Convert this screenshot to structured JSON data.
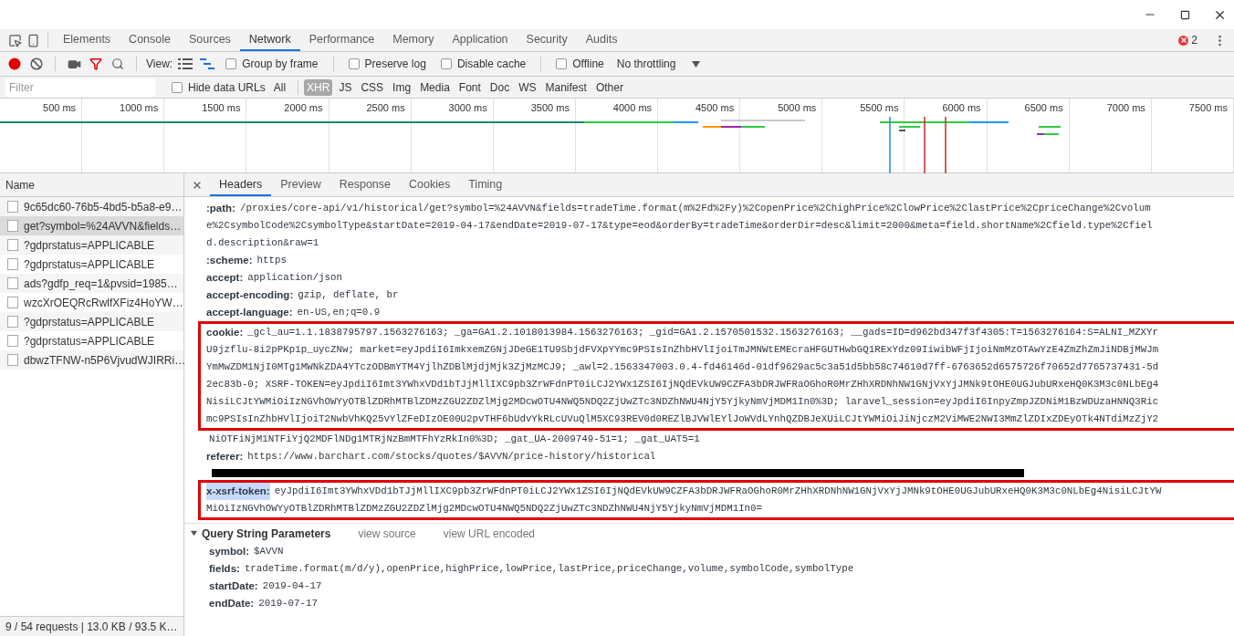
{
  "devtools_tabs": [
    {
      "label": "Elements",
      "selected": false
    },
    {
      "label": "Console",
      "selected": false
    },
    {
      "label": "Sources",
      "selected": false
    },
    {
      "label": "Network",
      "selected": true
    },
    {
      "label": "Performance",
      "selected": false
    },
    {
      "label": "Memory",
      "selected": false
    },
    {
      "label": "Application",
      "selected": false
    },
    {
      "label": "Security",
      "selected": false
    },
    {
      "label": "Audits",
      "selected": false
    }
  ],
  "error_count": "2",
  "toolbar": {
    "view_label": "View:",
    "view_modes": [
      {
        "kind": "list",
        "selected": false
      },
      {
        "kind": "waterfall",
        "selected": true
      }
    ],
    "checkbox_groups": [
      [
        {
          "label": "Group by frame",
          "checked": false
        }
      ],
      [
        {
          "label": "Preserve log",
          "checked": false
        },
        {
          "label": "Disable cache",
          "checked": false
        }
      ],
      [
        {
          "label": "Offline",
          "checked": false
        }
      ]
    ],
    "throttling": "No throttling"
  },
  "filter_bar": {
    "placeholder": "Filter",
    "hide_data_urls": {
      "label": "Hide data URLs",
      "checked": false
    },
    "types": [
      {
        "label": "All",
        "selected": false
      },
      {
        "label": "XHR",
        "selected": true
      },
      {
        "label": "JS",
        "selected": false
      },
      {
        "label": "CSS",
        "selected": false
      },
      {
        "label": "Img",
        "selected": false
      },
      {
        "label": "Media",
        "selected": false
      },
      {
        "label": "Font",
        "selected": false
      },
      {
        "label": "Doc",
        "selected": false
      },
      {
        "label": "WS",
        "selected": false
      },
      {
        "label": "Manifest",
        "selected": false
      },
      {
        "label": "Other",
        "selected": false
      }
    ]
  },
  "timeline": {
    "ticks": [
      "500 ms",
      "1000 ms",
      "1500 ms",
      "2000 ms",
      "2500 ms",
      "3000 ms",
      "3500 ms",
      "4000 ms",
      "4500 ms",
      "5000 ms",
      "5500 ms",
      "6000 ms",
      "6500 ms",
      "7000 ms",
      "7500 ms"
    ]
  },
  "requests": {
    "column": "Name",
    "rows": [
      {
        "name": "9c65dc60-76b5-4bd5-b5a8-e9…",
        "selected": false
      },
      {
        "name": "get?symbol=%24AVVN&fields…",
        "selected": true
      },
      {
        "name": "?gdprstatus=APPLICABLE",
        "selected": false
      },
      {
        "name": "?gdprstatus=APPLICABLE",
        "selected": false
      },
      {
        "name": "ads?gdfp_req=1&pvsid=1985…",
        "selected": false
      },
      {
        "name": "wzcXrOEQRcRwlfXFiz4HoYW…",
        "selected": false
      },
      {
        "name": "?gdprstatus=APPLICABLE",
        "selected": false
      },
      {
        "name": "?gdprstatus=APPLICABLE",
        "selected": false
      },
      {
        "name": "dbwzTFNW-n5P6VjvudWJIRRi…",
        "selected": false
      }
    ],
    "summary": "9 / 54 requests | 13.0 KB / 93.5 K…"
  },
  "detail_tabs": [
    {
      "label": "Headers",
      "selected": true
    },
    {
      "label": "Preview",
      "selected": false
    },
    {
      "label": "Response",
      "selected": false
    },
    {
      "label": "Cookies",
      "selected": false
    },
    {
      "label": "Timing",
      "selected": false
    }
  ],
  "headers": [
    {
      "kind": "header",
      "name": ":path:",
      "boxed": false,
      "name_selected": false,
      "lines": [
        "/proxies/core-api/v1/historical/get?symbol=%24AVVN&fields=tradeTime.format(m%2Fd%2Fy)%2CopenPrice%2ChighPrice%2ClowPrice%2ClastPrice%2CpriceChange%2Cvolum",
        "e%2CsymbolCode%2CsymbolType&startDate=2019-04-17&endDate=2019-07-17&type=eod&orderBy=tradeTime&orderDir=desc&limit=2000&meta=field.shortName%2Cfield.type%2Cfiel",
        "d.description&raw=1"
      ]
    },
    {
      "kind": "header",
      "name": ":scheme:",
      "boxed": false,
      "name_selected": false,
      "lines": [
        "https"
      ]
    },
    {
      "kind": "header",
      "name": "accept:",
      "boxed": false,
      "name_selected": false,
      "lines": [
        "application/json"
      ]
    },
    {
      "kind": "header",
      "name": "accept-encoding:",
      "boxed": false,
      "name_selected": false,
      "lines": [
        "gzip, deflate, br"
      ]
    },
    {
      "kind": "header",
      "name": "accept-language:",
      "boxed": false,
      "name_selected": false,
      "lines": [
        "en-US,en;q=0.9"
      ]
    },
    {
      "kind": "header",
      "name": "cookie:",
      "boxed": true,
      "name_selected": false,
      "lines": [
        "_gcl_au=1.1.1838795797.1563276163; _ga=GA1.2.1018013984.1563276163; _gid=GA1.2.1570501532.1563276163; __gads=ID=d962bd347f3f4305:T=1563276164:S=ALNI_MZXYr",
        "U9jzflu-8i2pPKp1p_uycZNw; market=eyJpdiI6ImkxemZGNjJDeGE1TU9SbjdFVXpYYmc9PSIsInZhbHVlIjoiTmJMNWtEMEcraHFGUTHwbGQ1RExYdz09IiwibWFjIjoiNmMzOTAwYzE4ZmZhZmJiNDBjMWJm",
        "YmMwZDM1NjI0MTg1MWNkZDA4YTczODBmYTM4YjlhZDBlMjdjMjk3ZjMzMCJ9; _awl=2.1563347003.0.4-fd46146d-01df9629ac5c3a51d5bb58c74610d7ff-6763652d6575726f70652d7765737431-5d",
        "2ec83b-0; XSRF-TOKEN=eyJpdiI6Imt3YWhxVDd1bTJjMllIXC9pb3ZrWFdnPT0iLCJ2YWx1ZSI6IjNQdEVkUW9CZFA3bDRJWFRaOGhoR0MrZHhXRDNhNW1GNjVxYjJMNk9tOHE0UGJubURxeHQ0K3M3c0NLbEg4",
        "NisiLCJtYWMiOiIzNGVhOWYyOTBlZDRhMTBlZDMzZGU2ZDZlMjg2MDcwOTU4NWQ5NDQ2ZjUwZTc3NDZhNWU4NjY5YjkyNmVjMDM1In0%3D; laravel_session=eyJpdiI6InpyZmpJZDNiM1BzWDUzaHNNQ3Ric",
        "mc9PSIsInZhbHVlIjoiT2NwbVhKQ25vYlZFeDIzOE00U2pvTHF6bUdvYkRLcUVuQlM5XC93REV0d0REZlBJVWlEYlJoWVdLYnhQZDBJeXUiLCJtYWMiOiJiNjczM2ViMWE2NWI3MmZlZDIxZDEyOTk4NTdiMzZjY2"
      ]
    },
    {
      "kind": "continuation",
      "lines": [
        "NiOTFiNjM1NTFiYjQ2MDFlNDg1MTRjNzBmMTFhYzRkIn0%3D; _gat_UA-2009749-51=1; _gat_UAT5=1"
      ]
    },
    {
      "kind": "header",
      "name": "referer:",
      "boxed": false,
      "name_selected": false,
      "lines": [
        "https://www.barchart.com/stocks/quotes/$AVVN/price-history/historical"
      ]
    },
    {
      "kind": "redacted"
    },
    {
      "kind": "header",
      "name": "x-xsrf-token:",
      "boxed": true,
      "name_selected": true,
      "lines": [
        "eyJpdiI6Imt3YWhxVDd1bTJjMllIXC9pb3ZrWFdnPT0iLCJ2YWx1ZSI6IjNQdEVkUW9CZFA3bDRJWFRaOGhoR0MrZHhXRDNhNW1GNjVxYjJMNk9tOHE0UGJubURxeHQ0K3M3c0NLbEg4NisiLCJtYW",
        "MiOiIzNGVhOWYyOTBlZDRhMTBlZDMzZGU2ZDZlMjg2MDcwOTU4NWQ5NDQ2ZjUwZTc3NDZhNWU4NjY5YjkyNmVjMDM1In0="
      ]
    }
  ],
  "query_section": {
    "title": "Query String Parameters",
    "expanded": true,
    "links": [
      "view source",
      "view URL encoded"
    ],
    "params": [
      {
        "name": "symbol:",
        "value": "$AVVN"
      },
      {
        "name": "fields:",
        "value": "tradeTime.format(m/d/y),openPrice,highPrice,lowPrice,lastPrice,priceChange,volume,symbolCode,symbolType"
      },
      {
        "name": "startDate:",
        "value": "2019-04-17"
      },
      {
        "name": "endDate:",
        "value": "2019-07-17"
      }
    ]
  }
}
